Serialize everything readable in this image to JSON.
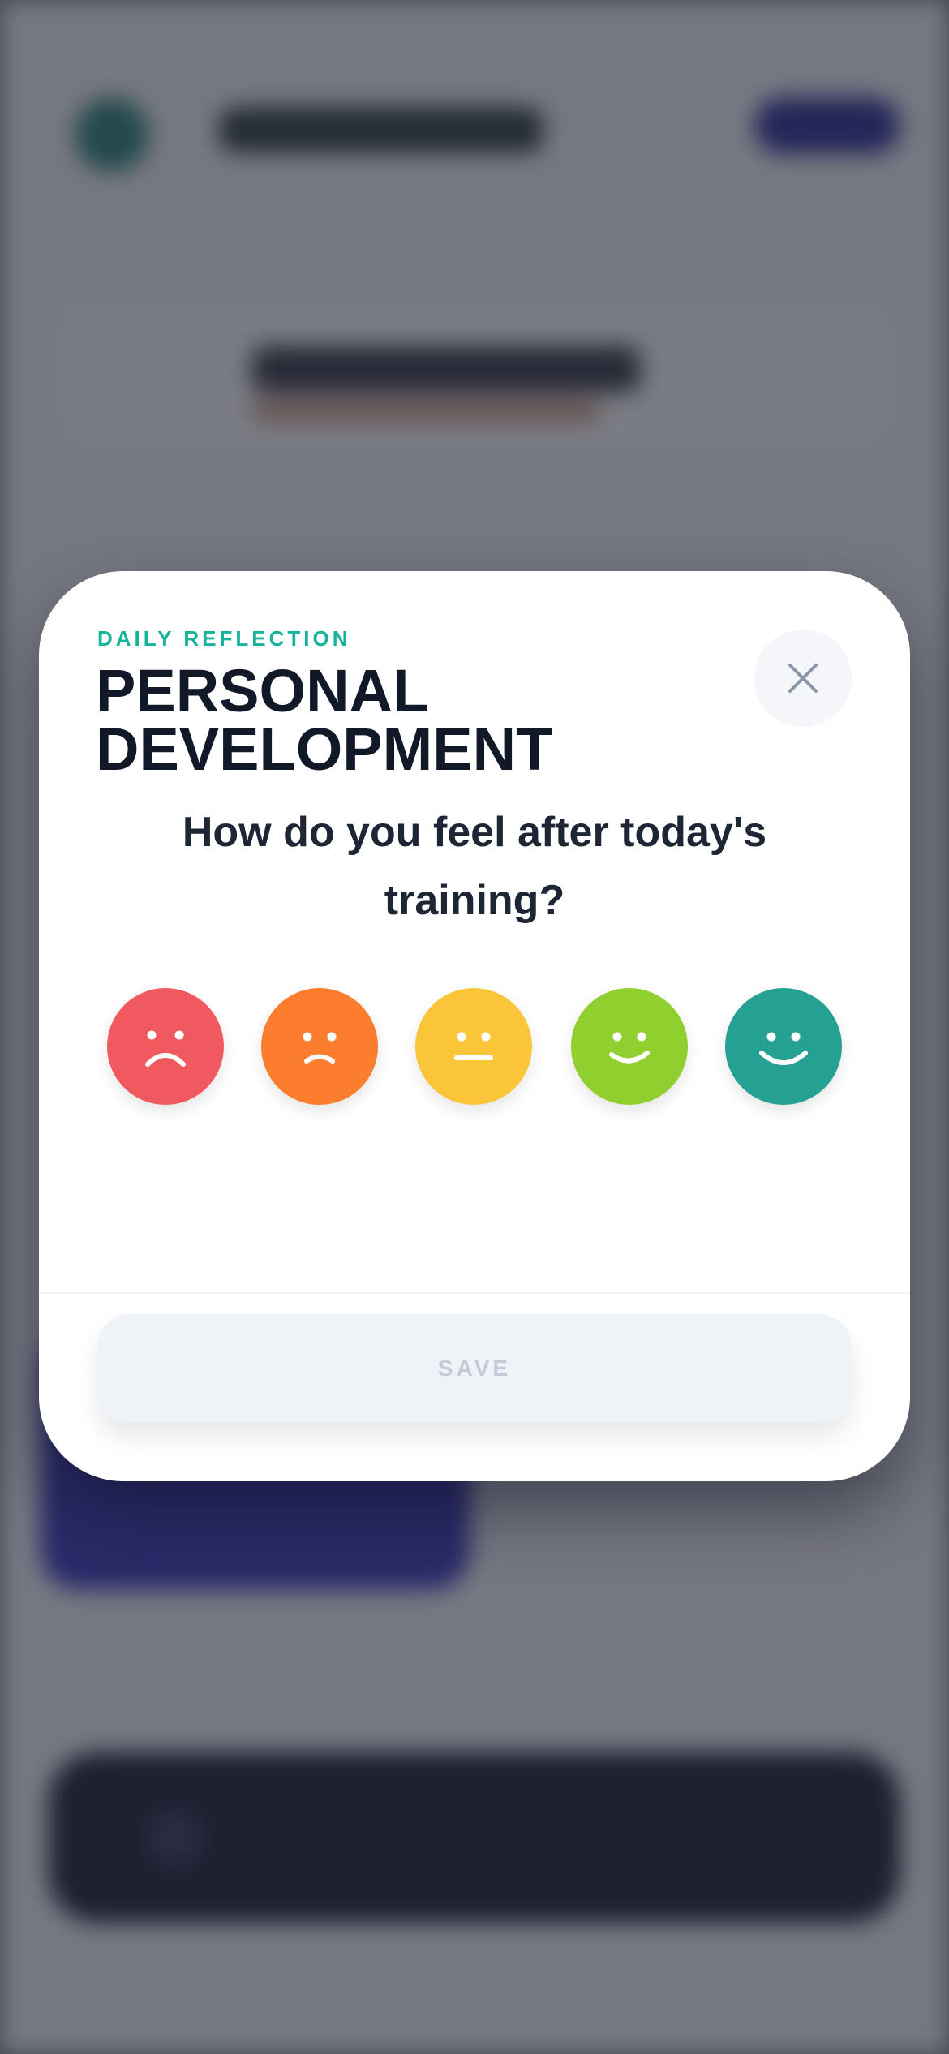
{
  "modal": {
    "eyebrow": "DAILY REFLECTION",
    "title": "PERSONAL DEVELOPMENT",
    "question": "How do you feel after today's training?",
    "save_label": "SAVE",
    "close_icon": "close-icon"
  },
  "mood_options": [
    {
      "icon": "very-sad-face-icon",
      "color": "#f05a5e"
    },
    {
      "icon": "sad-face-icon",
      "color": "#fb7d2d"
    },
    {
      "icon": "neutral-face-icon",
      "color": "#fbc53a"
    },
    {
      "icon": "happy-face-icon",
      "color": "#8fd02e"
    },
    {
      "icon": "very-happy-face-icon",
      "color": "#24a193"
    }
  ],
  "colors": {
    "accent": "#14b39a",
    "title": "#111827",
    "save_disabled_bg": "#eff3f8",
    "save_disabled_text": "#c3cbd8"
  }
}
